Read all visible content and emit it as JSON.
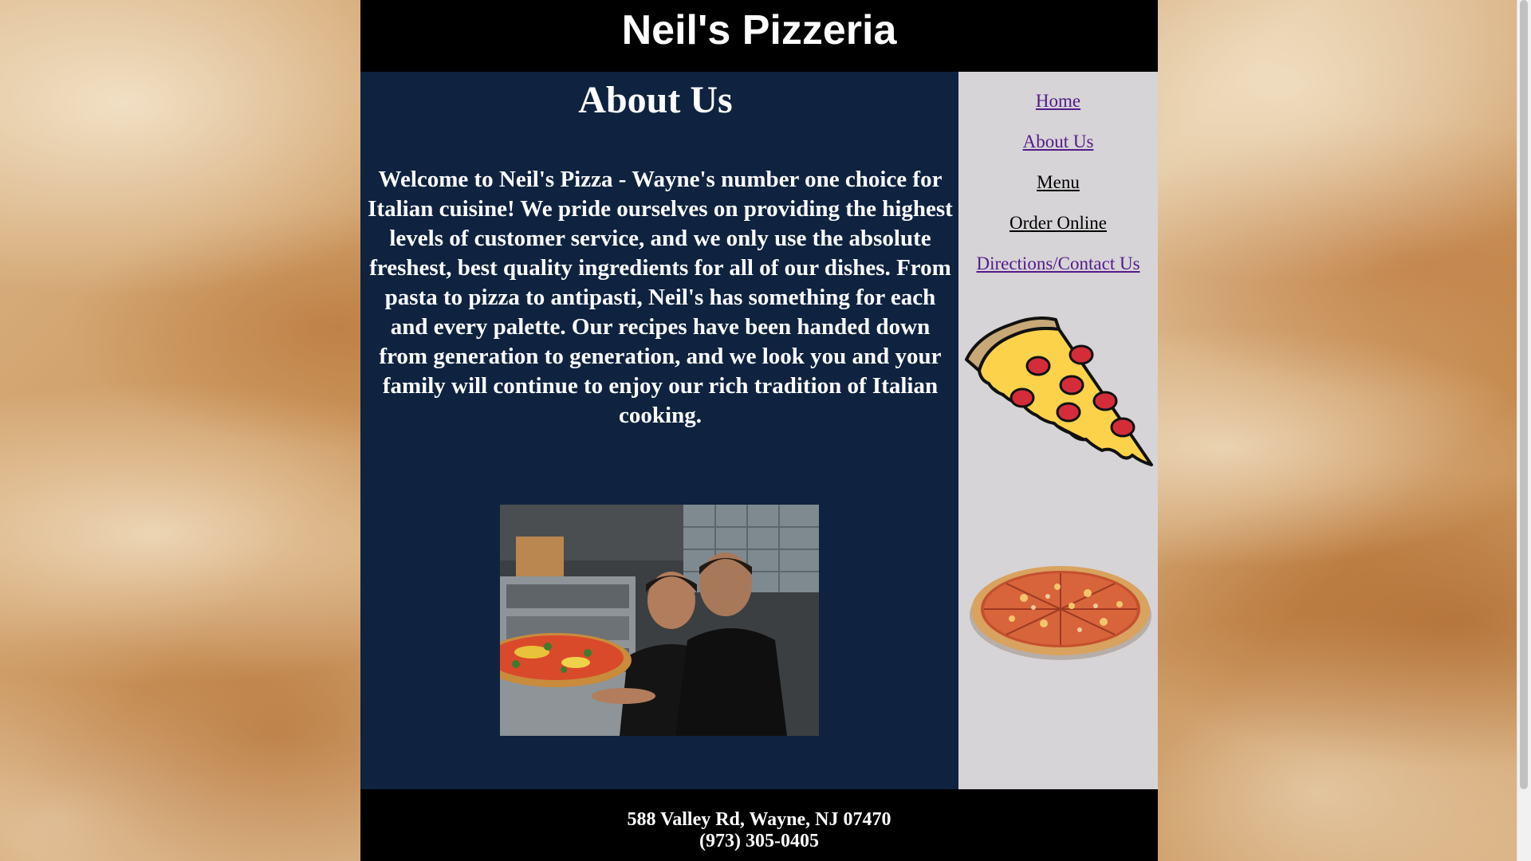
{
  "header": {
    "title": "Neil's Pizzeria"
  },
  "main": {
    "heading": "About Us",
    "body_text": "Welcome to Neil's Pizza - Wayne's number one choice for Italian cuisine! We pride ourselves on providing the highest levels of customer service, and we only use the absolute freshest, best quality ingredients for all of our dishes. From pasta to pizza to antipasti, Neil's has something for each and every palette. Our recipes have been handed down from generation to generation, and we look you and your family will continue to enjoy our rich tradition of Italian cooking.",
    "photo_icon": "owners-photo"
  },
  "sidebar": {
    "nav": [
      {
        "label": "Home",
        "visited": true
      },
      {
        "label": "About Us",
        "visited": true
      },
      {
        "label": "Menu",
        "visited": false
      },
      {
        "label": "Order Online",
        "visited": false
      },
      {
        "label": "Directions/Contact Us",
        "visited": true
      }
    ],
    "images": [
      "pizza-slice-icon",
      "whole-pizza-icon"
    ]
  },
  "footer": {
    "address": "588 Valley Rd, Wayne, NJ 07470",
    "phone": "(973) 305-0405"
  },
  "colors": {
    "header_bg": "#000000",
    "main_bg": "#0f2340",
    "sidebar_bg": "#d6d4d6",
    "visited_link": "#551a8b",
    "link": "#000000"
  }
}
